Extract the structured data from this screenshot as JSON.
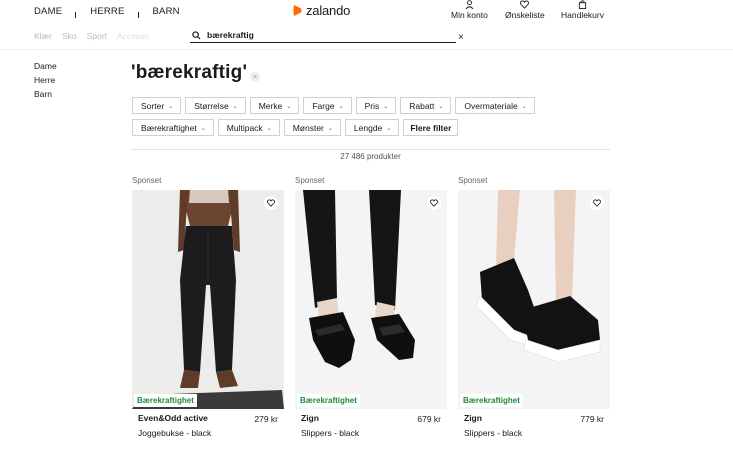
{
  "header": {
    "genders": [
      "DAME",
      "HERRE",
      "BARN"
    ],
    "categories": [
      "Klær",
      "Sko",
      "Sport",
      "Accesso"
    ],
    "logo_text": "zalando",
    "search": {
      "value": "bærekraftig"
    },
    "clear_symbol": "×",
    "actions": {
      "account": "Min konto",
      "wishlist": "Ønskeliste",
      "cart": "Handlekurv"
    }
  },
  "sidebar": {
    "items": [
      "Dame",
      "Herre",
      "Barn"
    ]
  },
  "page": {
    "title": "'bærekraftig'",
    "title_clear": "×",
    "result_count": "27 486 produkter"
  },
  "filters": {
    "row1": [
      "Sorter",
      "Størrelse",
      "Merke",
      "Farge",
      "Pris",
      "Rabatt",
      "Overmateriale"
    ],
    "row2": [
      "Bærekraftighet",
      "Multipack",
      "Mønster",
      "Lengde"
    ],
    "more": "Flere filter",
    "chevron": "⌄"
  },
  "products": [
    {
      "sponsored": "Sponset",
      "badge": "Bærekraftighet",
      "brand": "Even&Odd active",
      "price": "279 kr",
      "name": "Joggebukse - black"
    },
    {
      "sponsored": "Sponset",
      "badge": "Bærekraftighet",
      "brand": "Zign",
      "price": "679 kr",
      "name": "Slippers - black"
    },
    {
      "sponsored": "Sponset",
      "badge": "Bærekraftighet",
      "brand": "Zign",
      "price": "779 kr",
      "name": "Slippers - black"
    }
  ],
  "colors": {
    "brand_orange": "#ff6900",
    "sustainability_green": "#1f8a3f"
  }
}
